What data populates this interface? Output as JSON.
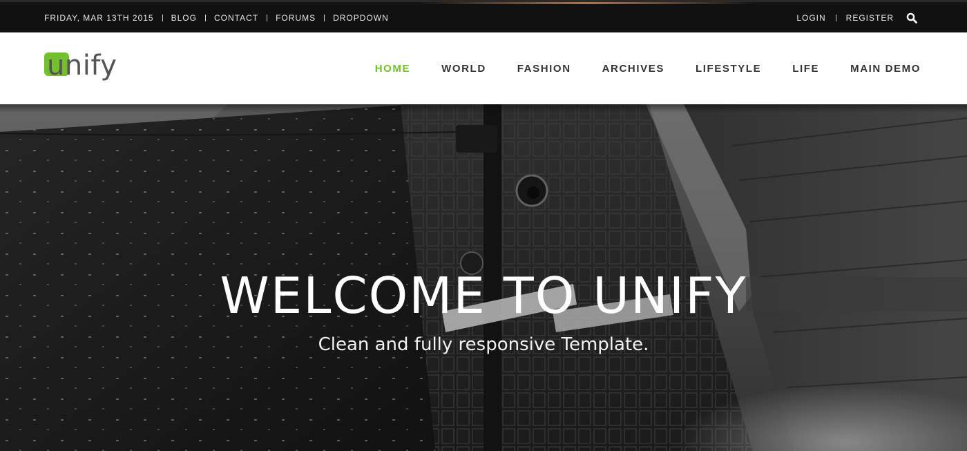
{
  "topbar": {
    "date": "FRIDAY, MAR 13TH 2015",
    "links": [
      "BLOG",
      "CONTACT",
      "FORUMS",
      "DROPDOWN"
    ],
    "login": "LOGIN",
    "register": "REGISTER",
    "search_icon": "search-icon"
  },
  "header": {
    "logo_text": "unify",
    "nav": [
      {
        "label": "HOME",
        "active": true
      },
      {
        "label": "WORLD",
        "active": false
      },
      {
        "label": "FASHION",
        "active": false
      },
      {
        "label": "ARCHIVES",
        "active": false
      },
      {
        "label": "LIFESTYLE",
        "active": false
      },
      {
        "label": "LIFE",
        "active": false
      },
      {
        "label": "MAIN DEMO",
        "active": false
      }
    ]
  },
  "hero": {
    "title": "WELCOME TO UNIFY",
    "subtitle": "Clean and fully responsive Template."
  },
  "colors": {
    "accent": "#72c02c",
    "topbar_bg": "#111111",
    "header_bg": "#ffffff",
    "nav_text": "#333333"
  }
}
